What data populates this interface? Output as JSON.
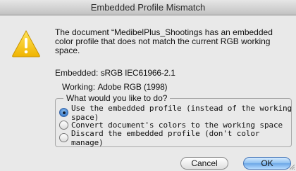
{
  "dialog": {
    "title": "Embedded Profile Mismatch",
    "message_prefix": "The document “",
    "document_name": "MedibelPlus_Shootings",
    "message_rest": " has an embedded color profile that does not match the current RGB working space.",
    "embedded_label": "Embedded:",
    "embedded_value": "sRGB IEC61966-2.1",
    "working_label": "Working:",
    "working_value": "Adobe RGB (1998)"
  },
  "options": {
    "legend": "What would you like to do?",
    "items": [
      {
        "label": "Use the embedded profile (instead of the working space)",
        "selected": true
      },
      {
        "label": "Convert document's colors to the working space",
        "selected": false
      },
      {
        "label": "Discard the embedded profile (don't color manage)",
        "selected": false
      }
    ]
  },
  "buttons": {
    "cancel": "Cancel",
    "ok": "OK"
  },
  "icons": {
    "warning": "warning-triangle-icon",
    "resize": "resize-grip-icon"
  },
  "colors": {
    "warning_yellow": "#f5c400",
    "default_button_blue": "#6aa6e6"
  }
}
